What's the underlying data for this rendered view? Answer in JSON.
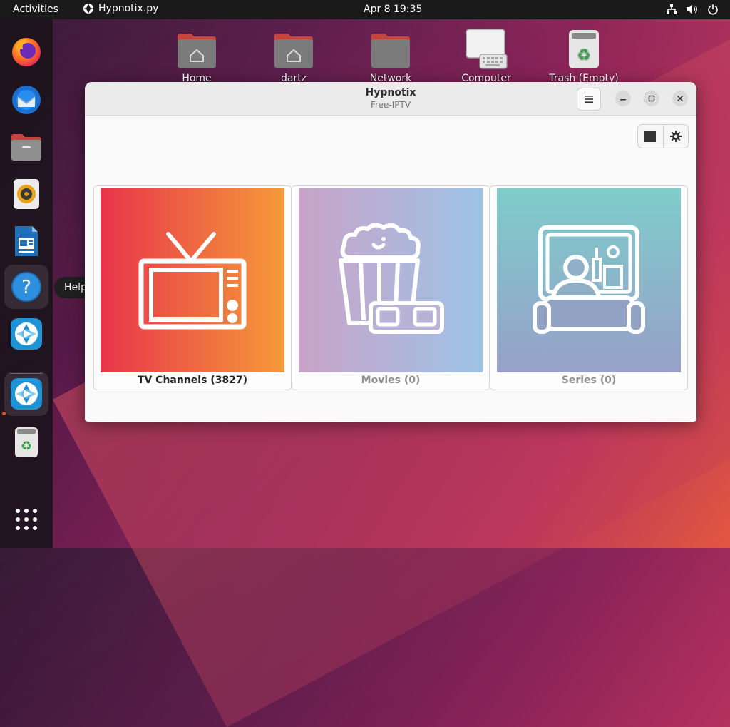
{
  "topbar": {
    "activities": "Activities",
    "app_name": "Hypnotix.py",
    "clock": "Apr 8  19:35"
  },
  "desktop_icons": [
    {
      "label": "Home"
    },
    {
      "label": "dartz"
    },
    {
      "label": "Network"
    },
    {
      "label": "Computer"
    },
    {
      "label": "Trash (Empty)"
    }
  ],
  "dock": {
    "tooltip": "Help"
  },
  "window": {
    "title": "Hypnotix",
    "subtitle": "Free-IPTV"
  },
  "cards": [
    {
      "label": "TV Channels (3827)",
      "gradient": [
        "#e8354a",
        "#f59a3a"
      ]
    },
    {
      "label": "Movies (0)",
      "gradient": [
        "#c9a3c8",
        "#9ec3e6"
      ]
    },
    {
      "label": "Series (0)",
      "gradient": [
        "#7ecdcb",
        "#97a0c9"
      ]
    }
  ],
  "colors": {
    "accent": "#e95420",
    "topbar": "#1a1a1a"
  }
}
